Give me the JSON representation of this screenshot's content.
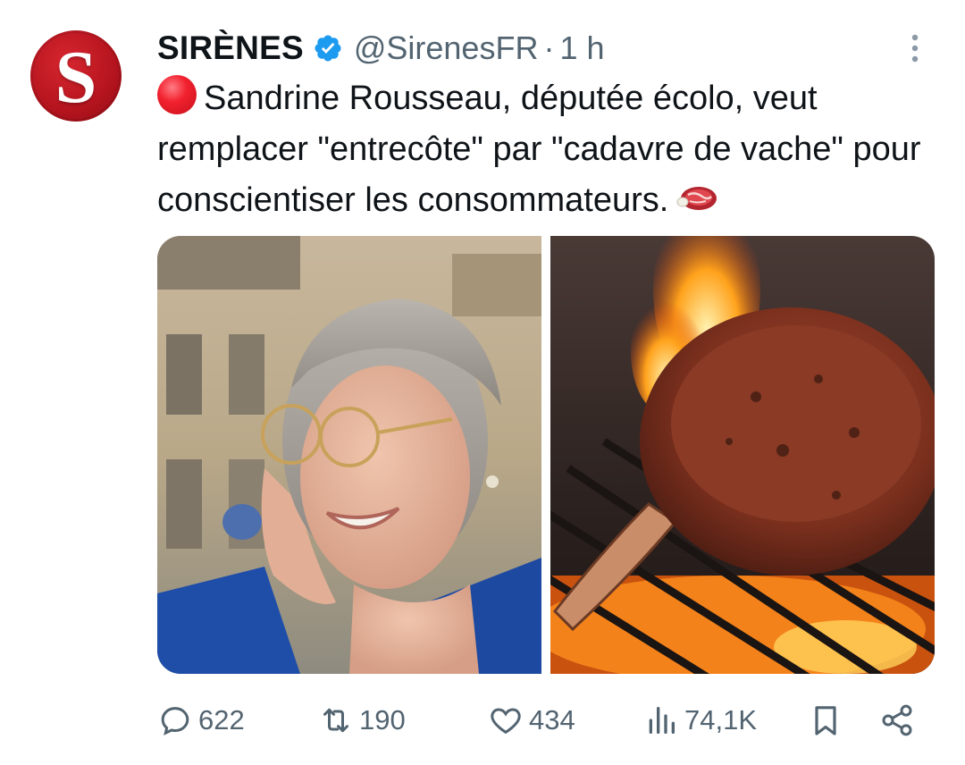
{
  "tweet": {
    "avatar_letter": "S",
    "display_name": "SIRÈNES",
    "handle": "@SirenesFR",
    "separator": "·",
    "time": "1 h",
    "text_main": "Sandrine Rousseau, députée écolo, veut remplacer \"entrecôte\" par \"cadavre de vache\" pour conscientiser les consommateurs.",
    "text_prefix_icon": "red-circle-emoji",
    "text_suffix_icon": "cut-of-meat-emoji",
    "images": [
      {
        "icon": "photo-portrait-woman-glasses"
      },
      {
        "icon": "photo-grilled-steak"
      }
    ]
  },
  "actions": {
    "replies": "622",
    "retweets": "190",
    "likes": "434",
    "views": "74,1K"
  },
  "colors": {
    "text": "#0f1419",
    "secondary": "#536471",
    "verified": "#1d9bf0",
    "avatar": "#c01822"
  }
}
